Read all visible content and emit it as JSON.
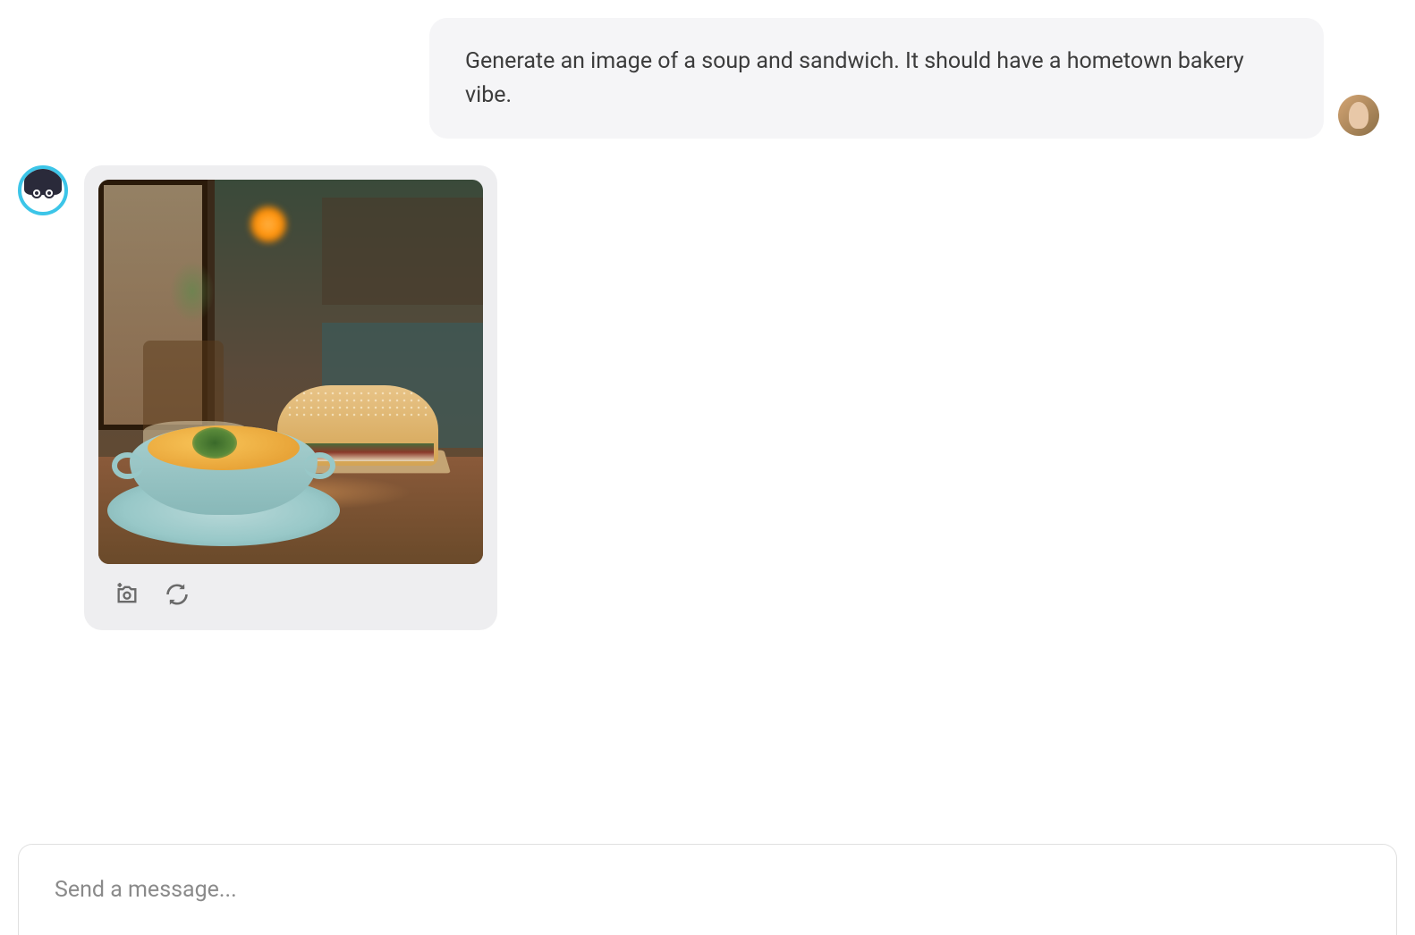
{
  "user_message": {
    "text": "Generate an image of a soup and sandwich. It should have a hometown bakery vibe."
  },
  "input": {
    "placeholder": "Send a message..."
  },
  "actions": {
    "camera": "add-image-icon",
    "refresh": "regenerate-icon"
  }
}
